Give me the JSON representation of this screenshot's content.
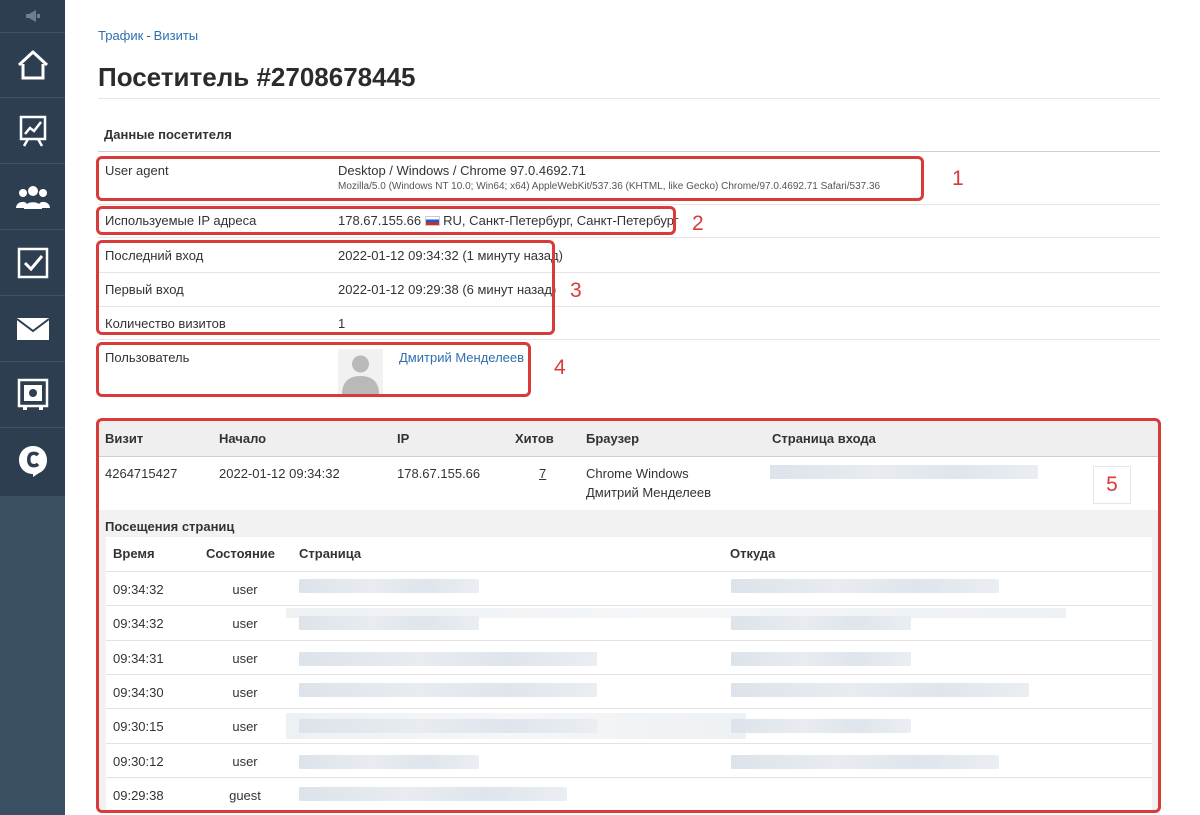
{
  "breadcrumb": {
    "item1": "Трафик",
    "separator": "-",
    "item2": "Визиты"
  },
  "page": {
    "title": "Посетитель #2708678445"
  },
  "visitor": {
    "section_title": "Данные посетителя",
    "user_agent_label": "User agent",
    "user_agent_value": "Desktop / Windows / Chrome 97.0.4692.71",
    "user_agent_raw": "Mozilla/5.0 (Windows NT 10.0; Win64; x64) AppleWebKit/537.36 (KHTML, like Gecko) Chrome/97.0.4692.71 Safari/537.36",
    "ip_label": "Используемые IP адреса",
    "ip_value": "178.67.155.66",
    "ip_location": "RU, Санкт-Петербург, Санкт-Петербург",
    "last_login_label": "Последний вход",
    "last_login_value": "2022-01-12 09:34:32 (1 минуту назад)",
    "first_login_label": "Первый вход",
    "first_login_value": "2022-01-12 09:29:38 (6 минут назад)",
    "visits_count_label": "Количество визитов",
    "visits_count_value": "1",
    "user_label": "Пользователь",
    "user_name": "Дмитрий Менделеев"
  },
  "visits_table": {
    "headers": [
      "Визит",
      "Начало",
      "IP",
      "Хитов",
      "Браузер",
      "Страница входа"
    ],
    "row": {
      "visit_id": "4264715427",
      "start": "2022-01-12 09:34:32",
      "ip": "178.67.155.66",
      "hits": "7",
      "browser": "Chrome Windows",
      "user": "Дмитрий Менделеев"
    }
  },
  "page_visits": {
    "title": "Посещения страниц",
    "headers": [
      "Время",
      "Состояние",
      "Страница",
      "Откуда"
    ],
    "rows": [
      {
        "time": "09:34:32",
        "state": "user"
      },
      {
        "time": "09:34:32",
        "state": "user"
      },
      {
        "time": "09:34:31",
        "state": "user"
      },
      {
        "time": "09:34:30",
        "state": "user"
      },
      {
        "time": "09:30:15",
        "state": "user"
      },
      {
        "time": "09:30:12",
        "state": "user"
      },
      {
        "time": "09:29:38",
        "state": "guest"
      }
    ]
  },
  "annotations": [
    "1",
    "2",
    "3",
    "4",
    "5"
  ],
  "sidebar": {
    "icons": [
      "megaphone-icon",
      "home-icon",
      "chart-icon",
      "users-icon",
      "checkbox-icon",
      "mail-icon",
      "safe-icon",
      "chat-c-icon"
    ]
  },
  "colors": {
    "sidebar": "#2c3e50",
    "accent_link": "#2f6fb0",
    "annotation": "#d93a3a"
  }
}
